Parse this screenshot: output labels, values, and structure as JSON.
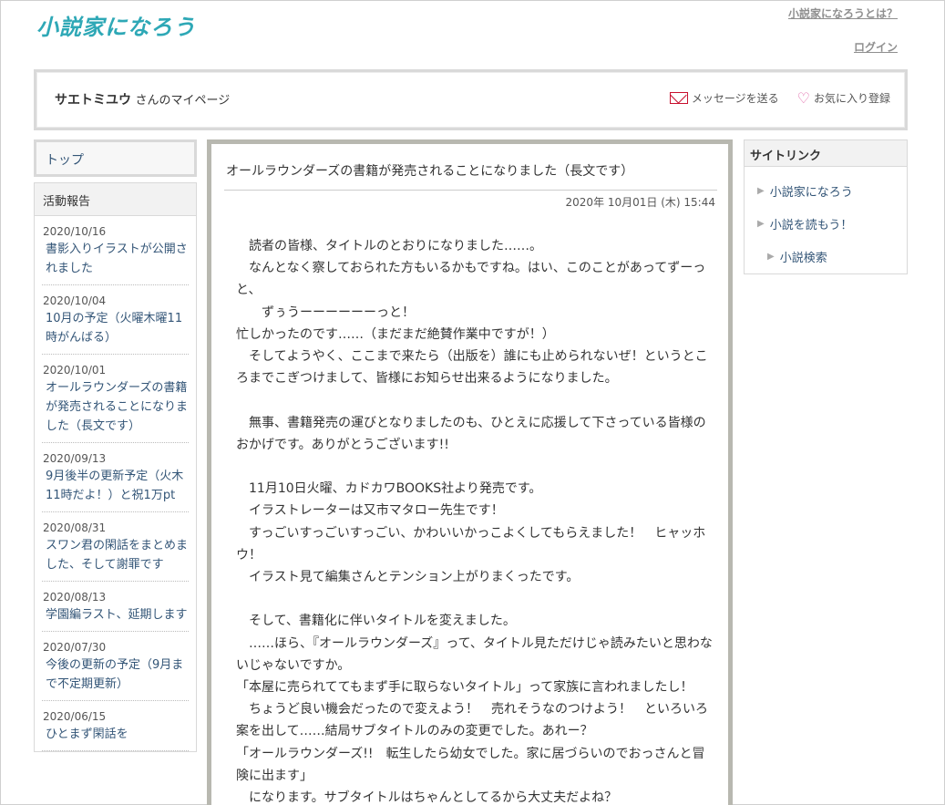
{
  "header": {
    "logo_text": "小説家になろう",
    "about_link": "小説家になろうとは？",
    "login_link": "ログイン"
  },
  "profile": {
    "name": "サエトミユウ",
    "suffix": "さんのマイページ",
    "send_message": "メッセージを送る",
    "favorite": "お気に入り登録"
  },
  "left": {
    "top_label": "トップ",
    "activity_heading": "活動報告",
    "items": [
      {
        "date": "2020/10/16",
        "title": "書影入りイラストが公開されました"
      },
      {
        "date": "2020/10/04",
        "title": "10月の予定（火曜木曜11時がんばる）"
      },
      {
        "date": "2020/10/01",
        "title": "オールラウンダーズの書籍が発売されることになりました（長文です）"
      },
      {
        "date": "2020/09/13",
        "title": "9月後半の更新予定（火木11時だよ！）と祝1万pt"
      },
      {
        "date": "2020/08/31",
        "title": "スワン君の閑話をまとめました、そして謝罪です"
      },
      {
        "date": "2020/08/13",
        "title": "学園編ラスト、延期します"
      },
      {
        "date": "2020/07/30",
        "title": "今後の更新の予定（9月まで不定期更新）"
      },
      {
        "date": "2020/06/15",
        "title": "ひとまず閑話を"
      }
    ]
  },
  "article": {
    "title": "オールラウンダーズの書籍が発売されることになりました（長文です）",
    "date": "2020年 10月01日 (木) 15:44",
    "body": [
      "　読者の皆様、タイトルのとおりになりました……。",
      "　なんとなく察しておられた方もいるかもですね。はい、このことがあってずーっと、",
      "　　ずぅうーーーーーーっと！",
      "忙しかったのです……（まだまだ絶賛作業中ですが！）",
      "　そしてようやく、ここまで来たら（出版を）誰にも止められないぜ！というところまでこぎつけまして、皆様にお知らせ出来るようになりました。",
      "",
      "　無事、書籍発売の運びとなりましたのも、ひとえに応援して下さっている皆様のおかげです。ありがとうございます!!",
      "",
      "　11月10日火曜、カドカワBOOKS社より発売です。",
      "　イラストレーターは又市マタロー先生です！",
      "　すっごいすっごいすっごい、かわいいかっこよくしてもらえました！　ヒャッホウ！",
      "　イラスト見て編集さんとテンション上がりまくったです。",
      "",
      "　そして、書籍化に伴いタイトルを変えました。",
      "　……ほら、『オールラウンダーズ』って、タイトル見ただけじゃ読みたいと思わないじゃないですか。",
      "「本屋に売られててもまず手に取らないタイトル」って家族に言われましたし！",
      "　ちょうど良い機会だったので変えよう！　売れそうなのつけよう！　といろいろ案を出して……結局サブタイトルのみの変更でした。あれー？",
      "「オールラウンダーズ!!　転生したら幼女でした。家に居づらいのでおっさんと冒険に出ます」",
      "　になります。サブタイトルはちゃんとしてるから大丈夫だよね？"
    ]
  },
  "right": {
    "heading": "サイトリンク",
    "links": [
      "小説家になろう",
      "小説を読もう！",
      "小説検索"
    ]
  },
  "colors": {
    "logo": "#2ea8b6",
    "link": "#335577",
    "main_border": "#b8b8b0",
    "mail_icon": "#c8102e",
    "heart_icon": "#e066a8"
  }
}
